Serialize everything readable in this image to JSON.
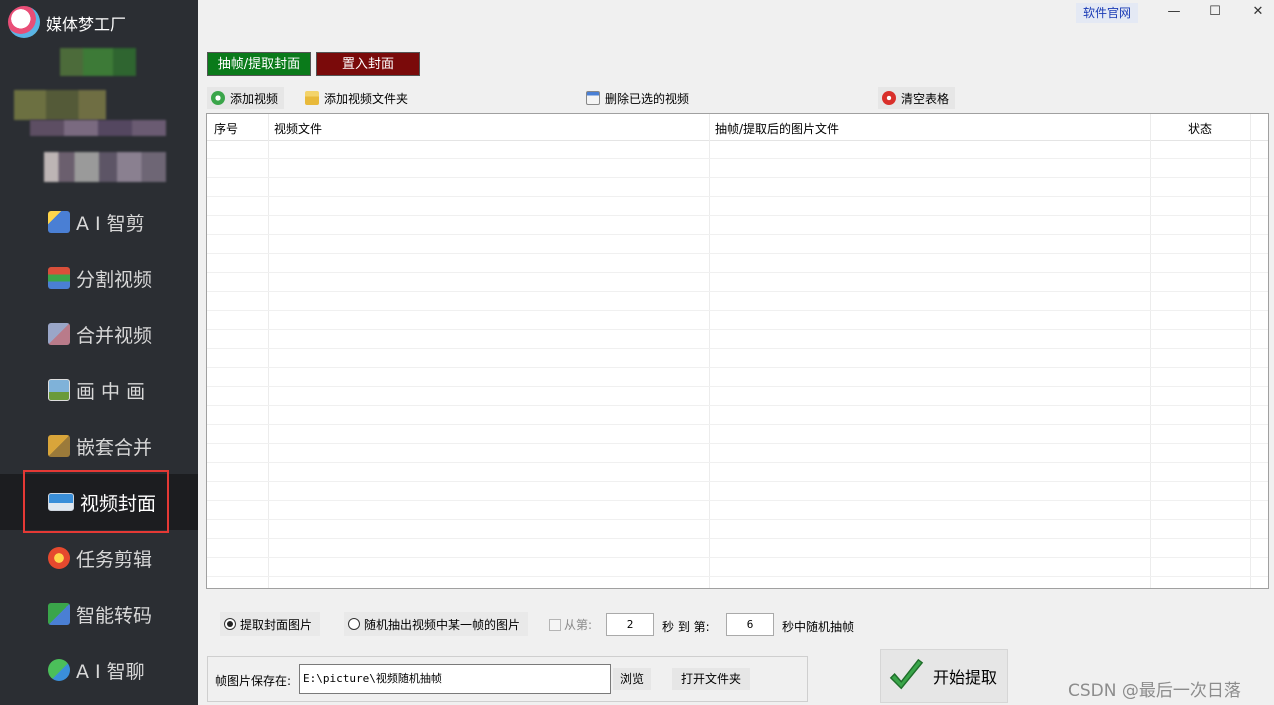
{
  "app": {
    "title": "媒体梦工厂",
    "official_link": "软件官网"
  },
  "window": {
    "minimize": "—",
    "maximize": "☐",
    "close": "✕"
  },
  "sidebar": {
    "items": [
      {
        "label": "A I 智剪",
        "icon": "ai-cut-icon",
        "color": "#4a7fd4"
      },
      {
        "label": "分割视频",
        "icon": "split-video-icon",
        "color": "#d94f3a"
      },
      {
        "label": "合并视频",
        "icon": "merge-video-icon",
        "color": "#b97b8a"
      },
      {
        "label": "画 中 画",
        "icon": "picture-in-picture-icon",
        "color": "#7fb2d9"
      },
      {
        "label": "嵌套合并",
        "icon": "nested-merge-icon",
        "color": "#d9a53a"
      },
      {
        "label": "视频封面",
        "icon": "video-cover-icon",
        "color": "#3a8fd9",
        "active": true
      },
      {
        "label": "任务剪辑",
        "icon": "task-edit-icon",
        "color": "#e6492e"
      },
      {
        "label": "智能转码",
        "icon": "smart-transcode-icon",
        "color": "#3aa54a"
      },
      {
        "label": "A I 智聊",
        "icon": "ai-chat-icon",
        "color": "#4bbf5a"
      }
    ]
  },
  "tabs": {
    "extract": "抽帧/提取封面",
    "insert": "置入封面"
  },
  "toolbar": {
    "add_video": "添加视频",
    "add_folder": "添加视频文件夹",
    "delete_selected": "删除已选的视频",
    "clear_table": "清空表格"
  },
  "table": {
    "columns": [
      "序号",
      "视频文件",
      "抽帧/提取后的图片文件",
      "状态"
    ],
    "rows": []
  },
  "options": {
    "radio_extract_cover": "提取封面图片",
    "radio_random_frame": "随机抽出视频中某一帧的图片",
    "from_label": "从第:",
    "from_value": "2",
    "sec_to_label": "秒 到 第:",
    "to_value": "6",
    "sec_random_label": "秒中随机抽帧"
  },
  "save": {
    "label": "帧图片保存在:",
    "path": "E:\\picture\\视频随机抽帧",
    "browse": "浏览",
    "open_folder": "打开文件夹"
  },
  "start_button": "开始提取",
  "watermark": "CSDN @最后一次日落",
  "colors": {
    "sidebar_bg": "#2b2e33",
    "tab_extract": "#0a7a1a",
    "tab_insert": "#7a0a0a",
    "highlight": "#e53935"
  }
}
